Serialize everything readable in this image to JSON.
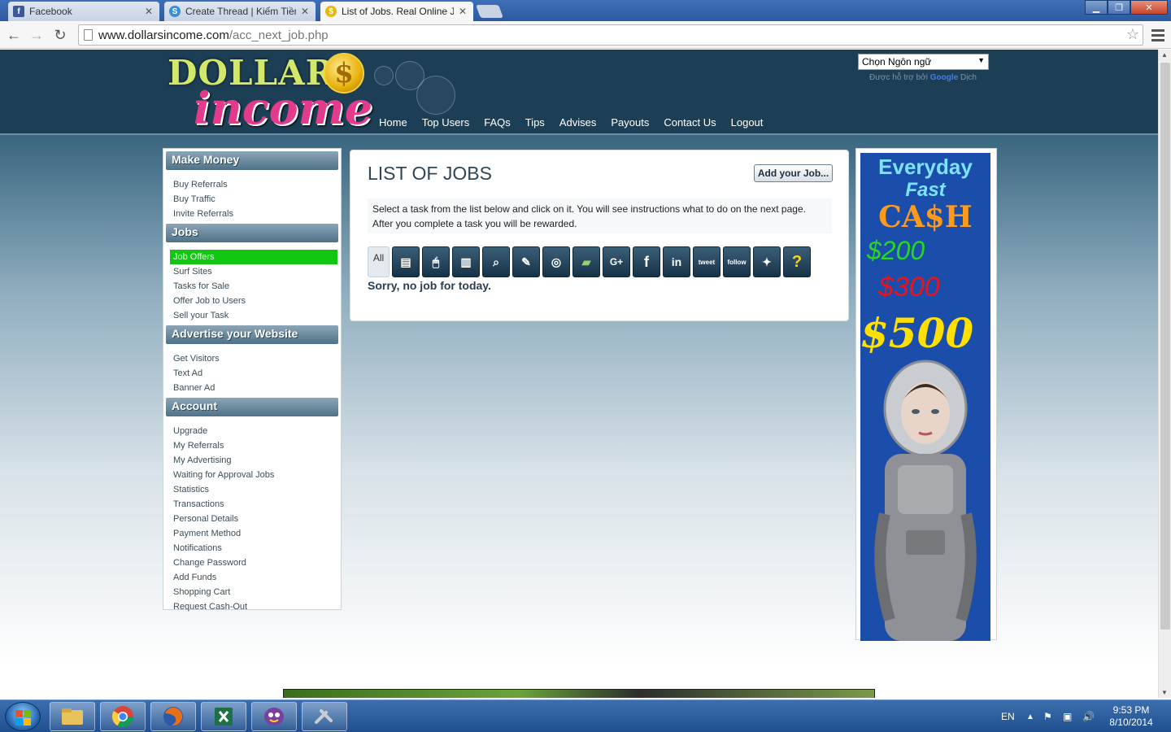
{
  "browser": {
    "tabs": [
      {
        "title": "Facebook",
        "active": false
      },
      {
        "title": "Create Thread | Kiếm Tiền",
        "active": false
      },
      {
        "title": "List of Jobs. Real Online Jo",
        "active": true
      }
    ],
    "url_domain": "www.dollarsincome.com",
    "url_path": "/acc_next_job.php"
  },
  "site": {
    "logo_top": "DOLLAR",
    "logo_coin": "$",
    "logo_bottom": "income",
    "nav": [
      "Home",
      "Top Users",
      "FAQs",
      "Tips",
      "Advises",
      "Payouts",
      "Contact Us",
      "Logout"
    ],
    "language_select": "Chọn Ngôn ngữ",
    "powered_by_prefix": "Được hỗ trợ bởi",
    "powered_by_brand": "Google",
    "powered_by_suffix": "Dịch"
  },
  "sidebar": {
    "sections": [
      {
        "title": "Make Money",
        "items": [
          "Buy Referrals",
          "Buy Traffic",
          "Invite Referrals"
        ]
      },
      {
        "title": "Jobs",
        "items": [
          "Job Offers",
          "Surf Sites",
          "Tasks for Sale",
          "Offer Job to Users",
          "Sell your Task"
        ],
        "active": "Job Offers"
      },
      {
        "title": "Advertise your Website",
        "items": [
          "Get Visitors",
          "Text Ad",
          "Banner Ad"
        ]
      },
      {
        "title": "Account",
        "items": [
          "Upgrade",
          "My Referrals",
          "My Advertising",
          "Waiting for Approval Jobs",
          "Statistics",
          "Transactions",
          "Personal Details",
          "Payment Method",
          "Notifications",
          "Change Password",
          "Add Funds",
          "Shopping Cart",
          "Request Cash-Out"
        ]
      }
    ]
  },
  "main": {
    "title": "LIST OF JOBS",
    "add_button": "Add your Job...",
    "instruction_line1": "Select a task from the list below and click on it. You will see instructions what to do on the next page.",
    "instruction_line2": "After you complete a task you will be rewarded.",
    "categories": [
      {
        "label": "All",
        "icon": "all-label"
      },
      {
        "label": "",
        "icon": "form-icon"
      },
      {
        "label": "",
        "icon": "mouse-icon"
      },
      {
        "label": "",
        "icon": "document-icon"
      },
      {
        "label": "",
        "icon": "search-document-icon"
      },
      {
        "label": "",
        "icon": "pen-icon"
      },
      {
        "label": "",
        "icon": "gamepad-icon"
      },
      {
        "label": "",
        "icon": "money-icon"
      },
      {
        "label": "G+",
        "icon": "google-plus-icon"
      },
      {
        "label": "f",
        "icon": "facebook-icon"
      },
      {
        "label": "in",
        "icon": "linkedin-icon"
      },
      {
        "label": "tweet",
        "icon": "twitter-tweet-icon"
      },
      {
        "label": "follow",
        "icon": "twitter-follow-icon"
      },
      {
        "label": "",
        "icon": "satellite-icon"
      },
      {
        "label": "?",
        "icon": "question-icon"
      }
    ],
    "empty_message": "Sorry, no job for today."
  },
  "ad_banner": {
    "line1": "Everyday",
    "line2": "Fast",
    "line3": "CA$H",
    "line4": "$200",
    "line5": "$300",
    "line6": "$500"
  },
  "taskbar": {
    "apps": [
      "file-explorer-icon",
      "chrome-icon",
      "firefox-icon",
      "excel-icon",
      "yahoo-messenger-icon",
      "tools-icon"
    ],
    "language": "EN",
    "time": "9:53 PM",
    "date": "8/10/2014"
  }
}
